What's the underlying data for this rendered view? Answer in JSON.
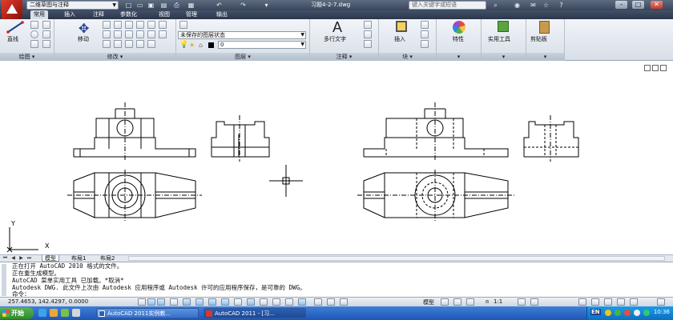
{
  "titlebar": {
    "workspace": "二维草图与注释",
    "doc_title": "习题4-2-7.dwg",
    "search_placeholder": "键入关键字或短语"
  },
  "ribbon_tabs": [
    "常用",
    "插入",
    "注释",
    "参数化",
    "视图",
    "管理",
    "输出"
  ],
  "ribbon": {
    "line_label": "直线",
    "move_label": "移动",
    "layer_state": "未保存的图层状态",
    "layer_current": "0",
    "mtext_label": "多行文字",
    "insert_label": "插入",
    "properties_label": "特性",
    "utilities_label": "实用工具",
    "clipboard_label": "剪贴板",
    "panels": {
      "draw": "绘图",
      "modify": "修改",
      "layers": "图层",
      "annotation": "注释",
      "block": "块"
    }
  },
  "ucs": {
    "x": "X",
    "y": "Y"
  },
  "layout_tabs": [
    "模型",
    "布局1",
    "布局2"
  ],
  "command": {
    "lines": [
      "正在打开 AutoCAD 2010 格式的文件。",
      "正在重生成模型。",
      "AutoCAD 菜单实用工具 已加载。*取消*",
      "Autodesk DWG.  此文件上次由 Autodesk 应用程序或 Autodesk 许可的应用程序保存，是可靠的 DWG。"
    ],
    "prompt": "命令："
  },
  "status": {
    "coords": "257.4653, 142.4297, 0.0000",
    "model_label": "模型",
    "scale": "1:1"
  },
  "taskbar": {
    "start": "开始",
    "items": [
      "AutoCAD 2011实例教...",
      "AutoCAD 2011 - [习..."
    ],
    "lang": "EN",
    "clock": "10:36"
  },
  "colors": {
    "title_bg": "#39465a",
    "tab_bg": "#2b3648",
    "taskbar": "#1e56b8",
    "start_green": "#2f8a2c"
  }
}
